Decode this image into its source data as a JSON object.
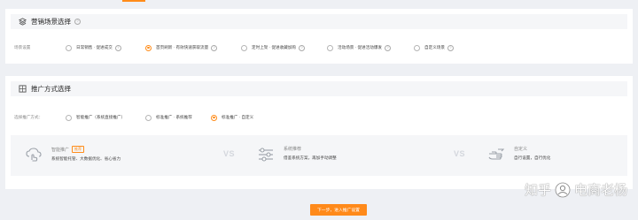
{
  "section1": {
    "title": "营销场景选择",
    "row_label": "场景设置",
    "options": [
      {
        "label": "日常销售 · 促进成交",
        "checked": false
      },
      {
        "label": "首页刷新 · 有效快速获取流量",
        "checked": true
      },
      {
        "label": "定时上架 · 促进收藏加购",
        "checked": false
      },
      {
        "label": "活动场景 · 促进活动爆发",
        "checked": false
      },
      {
        "label": "自定义场景",
        "checked": false
      }
    ]
  },
  "section2": {
    "title": "推广方式选择",
    "row_label": "选择推广方式：",
    "options": [
      {
        "label": "智能推广（系统直接推广）",
        "checked": false
      },
      {
        "label": "标准推广 · 系统推荐",
        "checked": false
      },
      {
        "label": "标准推广 · 自定义",
        "checked": true
      }
    ],
    "modes": [
      {
        "title": "智能推广",
        "badge": "推荐",
        "desc": "系统智能托管、大数据优化、省心省力",
        "icon": "cloud-hand-icon"
      },
      {
        "title": "系统推荐",
        "badge": "",
        "desc": "借鉴系统方案，再加手动调整",
        "icon": "sliders-icon"
      },
      {
        "title": "自定义",
        "badge": "",
        "desc": "自行设置，自行优化",
        "icon": "hand-icon"
      }
    ],
    "vs_label": "VS"
  },
  "next_button": {
    "label": "下一步，进入推广设置"
  },
  "watermark": {
    "text_left": "知乎",
    "text_right": "电商老杨"
  },
  "colors": {
    "accent": "#ff8c1a",
    "background": "#eef0f4",
    "panel": "#f5f6f8"
  }
}
